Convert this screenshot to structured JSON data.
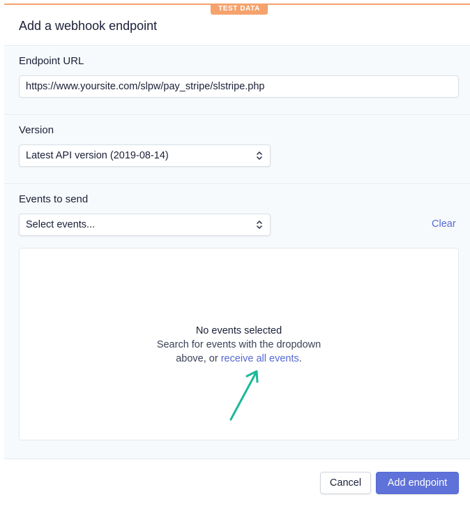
{
  "badge": "TEST DATA",
  "modal": {
    "title": "Add a webhook endpoint"
  },
  "endpoint": {
    "label": "Endpoint URL",
    "value": "https://www.yoursite.com/slpw/pay_stripe/slstripe.php"
  },
  "version": {
    "label": "Version",
    "selected": "Latest API version (2019-08-14)"
  },
  "events": {
    "label": "Events to send",
    "placeholder": "Select events...",
    "clear_label": "Clear",
    "empty_title": "No events selected",
    "empty_line1": "Search for events with the dropdown",
    "empty_line2_prefix": "above, or ",
    "empty_link": "receive all events",
    "empty_line2_suffix": "."
  },
  "footer": {
    "cancel_label": "Cancel",
    "submit_label": "Add endpoint"
  },
  "colors": {
    "accent": "#5469d4",
    "badge": "#f5a26d",
    "annotation_arrow": "#1db89a"
  },
  "icons": {
    "select_chevron": "chevron-up-down-icon",
    "annotation": "arrow-annotation-icon"
  }
}
